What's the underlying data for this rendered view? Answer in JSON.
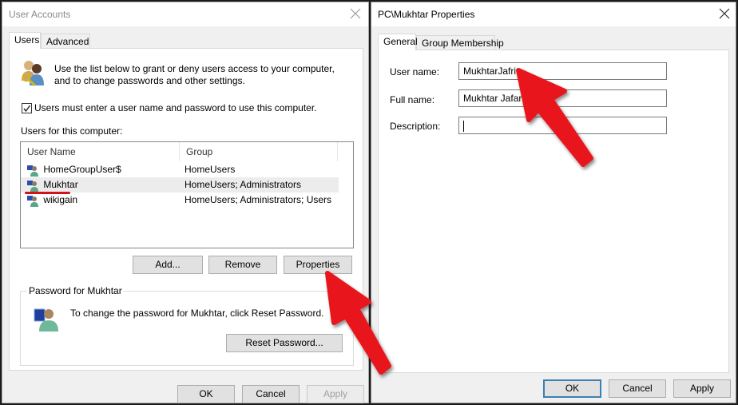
{
  "user_accounts": {
    "title": "User Accounts",
    "tabs": [
      {
        "label": "Users",
        "active": true
      },
      {
        "label": "Advanced",
        "active": false
      }
    ],
    "intro_line1": "Use the list below to grant or deny users access to your computer,",
    "intro_line2": "and to change passwords and other settings.",
    "require_login_checkbox": {
      "label": "Users must enter a user name and password to use this computer.",
      "checked": true
    },
    "users_label": "Users for this computer:",
    "columns": [
      "User Name",
      "Group"
    ],
    "users": [
      {
        "name": "HomeGroupUser$",
        "group": "HomeUsers",
        "selected": false
      },
      {
        "name": "Mukhtar",
        "group": "HomeUsers; Administrators",
        "selected": true
      },
      {
        "name": "wikigain",
        "group": "HomeUsers; Administrators; Users",
        "selected": false
      }
    ],
    "buttons": {
      "add": "Add...",
      "remove": "Remove",
      "properties": "Properties"
    },
    "password_group": {
      "label": "Password for Mukhtar",
      "text": "To change the password for Mukhtar, click Reset Password.",
      "reset_button": "Reset Password..."
    },
    "footer": {
      "ok": "OK",
      "cancel": "Cancel",
      "apply": "Apply",
      "apply_disabled": true
    }
  },
  "properties": {
    "title": "PC\\Mukhtar Properties",
    "tabs": [
      {
        "label": "General",
        "active": true
      },
      {
        "label": "Group Membership",
        "active": false
      }
    ],
    "fields": {
      "user_name": {
        "label": "User name:",
        "value": "MukhtarJafri"
      },
      "full_name": {
        "label": "Full name:",
        "value": "Mukhtar Jafari"
      },
      "description": {
        "label": "Description:",
        "value": ""
      }
    },
    "footer": {
      "ok": "OK",
      "cancel": "Cancel",
      "apply": "Apply"
    }
  },
  "annotations": {
    "arrow_color": "#e8141a",
    "underline_color": "#d0141a"
  }
}
